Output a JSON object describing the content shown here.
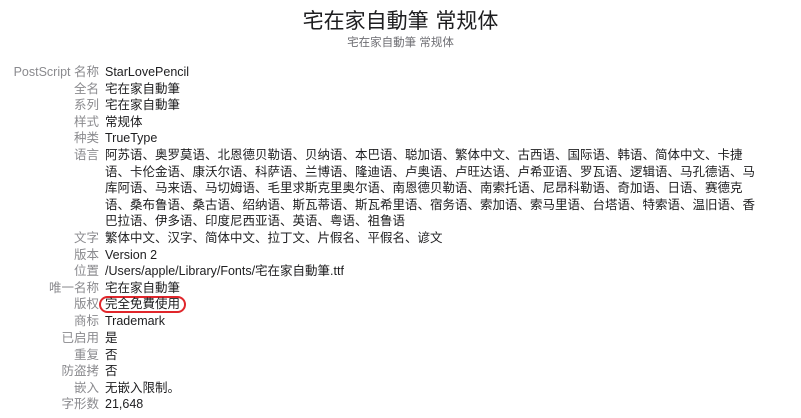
{
  "header": {
    "title": "宅在家自動筆 常规体",
    "subtitle": "宅在家自動筆 常规体"
  },
  "rows": [
    {
      "label": "PostScript 名称",
      "value": "StarLovePencil"
    },
    {
      "label": "全名",
      "value": "宅在家自動筆"
    },
    {
      "label": "系列",
      "value": "宅在家自動筆"
    },
    {
      "label": "样式",
      "value": "常规体"
    },
    {
      "label": "种类",
      "value": "TrueType"
    },
    {
      "label": "语言",
      "value": "阿苏语、奥罗莫语、北恩德贝勒语、贝纳语、本巴语、聪加语、繁体中文、古西语、国际语、韩语、简体中文、卡捷语、卡伦金语、康沃尔语、科萨语、兰博语、隆迪语、卢奥语、卢旺达语、卢希亚语、罗瓦语、逻辑语、马孔德语、马库阿语、马来语、马切姆语、毛里求斯克里奥尔语、南恩德贝勒语、南索托语、尼昂科勒语、奇加语、日语、赛德克语、桑布鲁语、桑古语、绍纳语、斯瓦蒂语、斯瓦希里语、宿务语、索加语、索马里语、台塔语、特索语、温旧语、香巴拉语、伊多语、印度尼西亚语、英语、粤语、祖鲁语"
    },
    {
      "label": "文字",
      "value": "繁体中文、汉字、简体中文、拉丁文、片假名、平假名、谚文"
    },
    {
      "label": "版本",
      "value": "Version 2"
    },
    {
      "label": "位置",
      "value": "/Users/apple/Library/Fonts/宅在家自動筆.ttf"
    },
    {
      "label": "唯一名称",
      "value": "宅在家自動筆"
    },
    {
      "label": "版权",
      "value": "完全免費使用"
    },
    {
      "label": "商标",
      "value": "Trademark"
    },
    {
      "label": "已启用",
      "value": "是"
    },
    {
      "label": "重复",
      "value": "否"
    },
    {
      "label": "防盗拷",
      "value": "否"
    },
    {
      "label": "嵌入",
      "value": "无嵌入限制。"
    },
    {
      "label": "字形数",
      "value": "21,648"
    }
  ]
}
